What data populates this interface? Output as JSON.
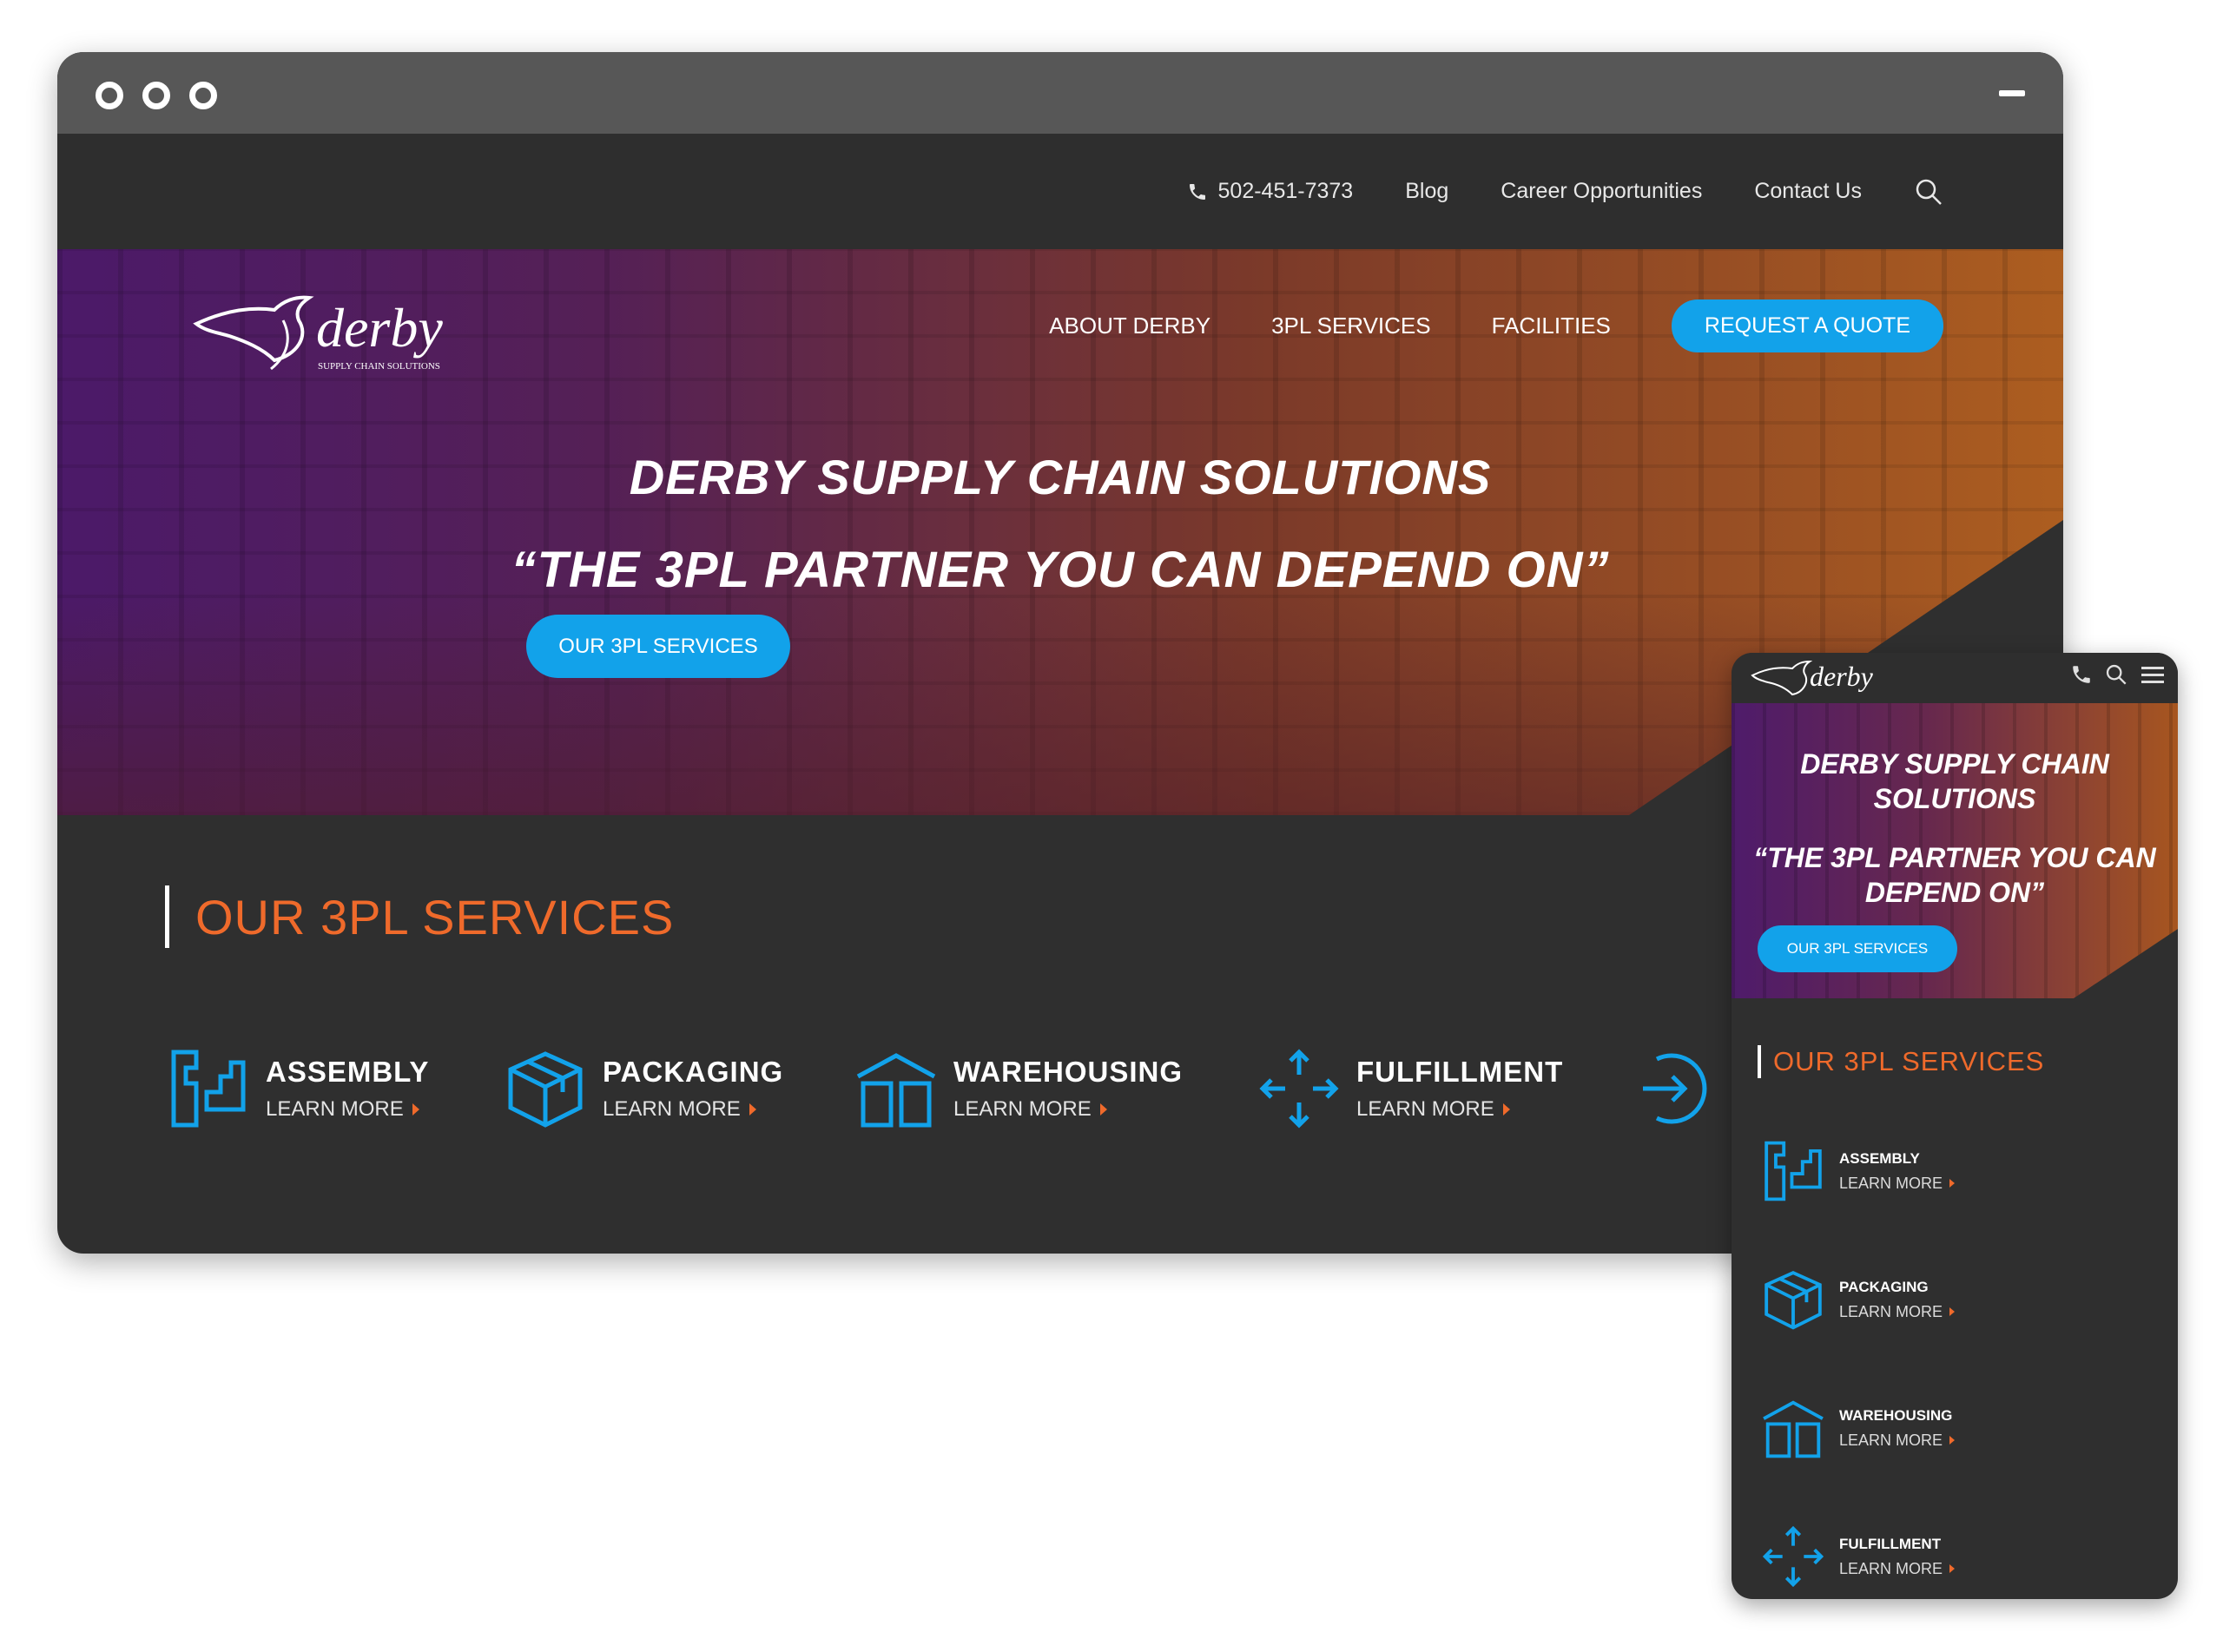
{
  "colors": {
    "accent_blue": "#12a2ea",
    "accent_orange": "#ef6a2b",
    "dark_bg": "#2f2f2f",
    "titlebar": "#575757"
  },
  "topbar": {
    "phone": "502-451-7373",
    "links": [
      "Blog",
      "Career Opportunities",
      "Contact Us"
    ],
    "icons": {
      "phone": "phone-icon",
      "search": "search-icon"
    }
  },
  "brand": {
    "logo_text": "derby",
    "logo_tagline": "SUPPLY CHAIN SOLUTIONS"
  },
  "nav": {
    "items": [
      "ABOUT DERBY",
      "3PL SERVICES",
      "FACILITIES"
    ],
    "cta": "REQUEST A QUOTE"
  },
  "hero": {
    "title": "DERBY SUPPLY CHAIN SOLUTIONS",
    "subtitle": "“THE 3PL PARTNER YOU CAN DEPEND ON”",
    "button": "OUR 3PL SERVICES"
  },
  "services": {
    "heading": "OUR 3PL SERVICES",
    "items": [
      {
        "name": "ASSEMBLY",
        "link": "LEARN MORE",
        "icon": "assembly-icon"
      },
      {
        "name": "PACKAGING",
        "link": "LEARN MORE",
        "icon": "box-icon"
      },
      {
        "name": "WAREHOUSING",
        "link": "LEARN MORE",
        "icon": "warehouse-icon"
      },
      {
        "name": "FULFILLMENT",
        "link": "LEARN MORE",
        "icon": "arrows-icon"
      }
    ],
    "next_icon": "arrow-right-circle-icon"
  },
  "mobile": {
    "hero_title": "DERBY SUPPLY CHAIN SOLUTIONS",
    "hero_subtitle": "“THE 3PL PARTNER YOU CAN DEPEND ON”",
    "hero_button": "OUR 3PL SERVICES",
    "heading": "OUR 3PL SERVICES",
    "icons": [
      "phone-icon",
      "search-icon",
      "menu-icon"
    ]
  }
}
